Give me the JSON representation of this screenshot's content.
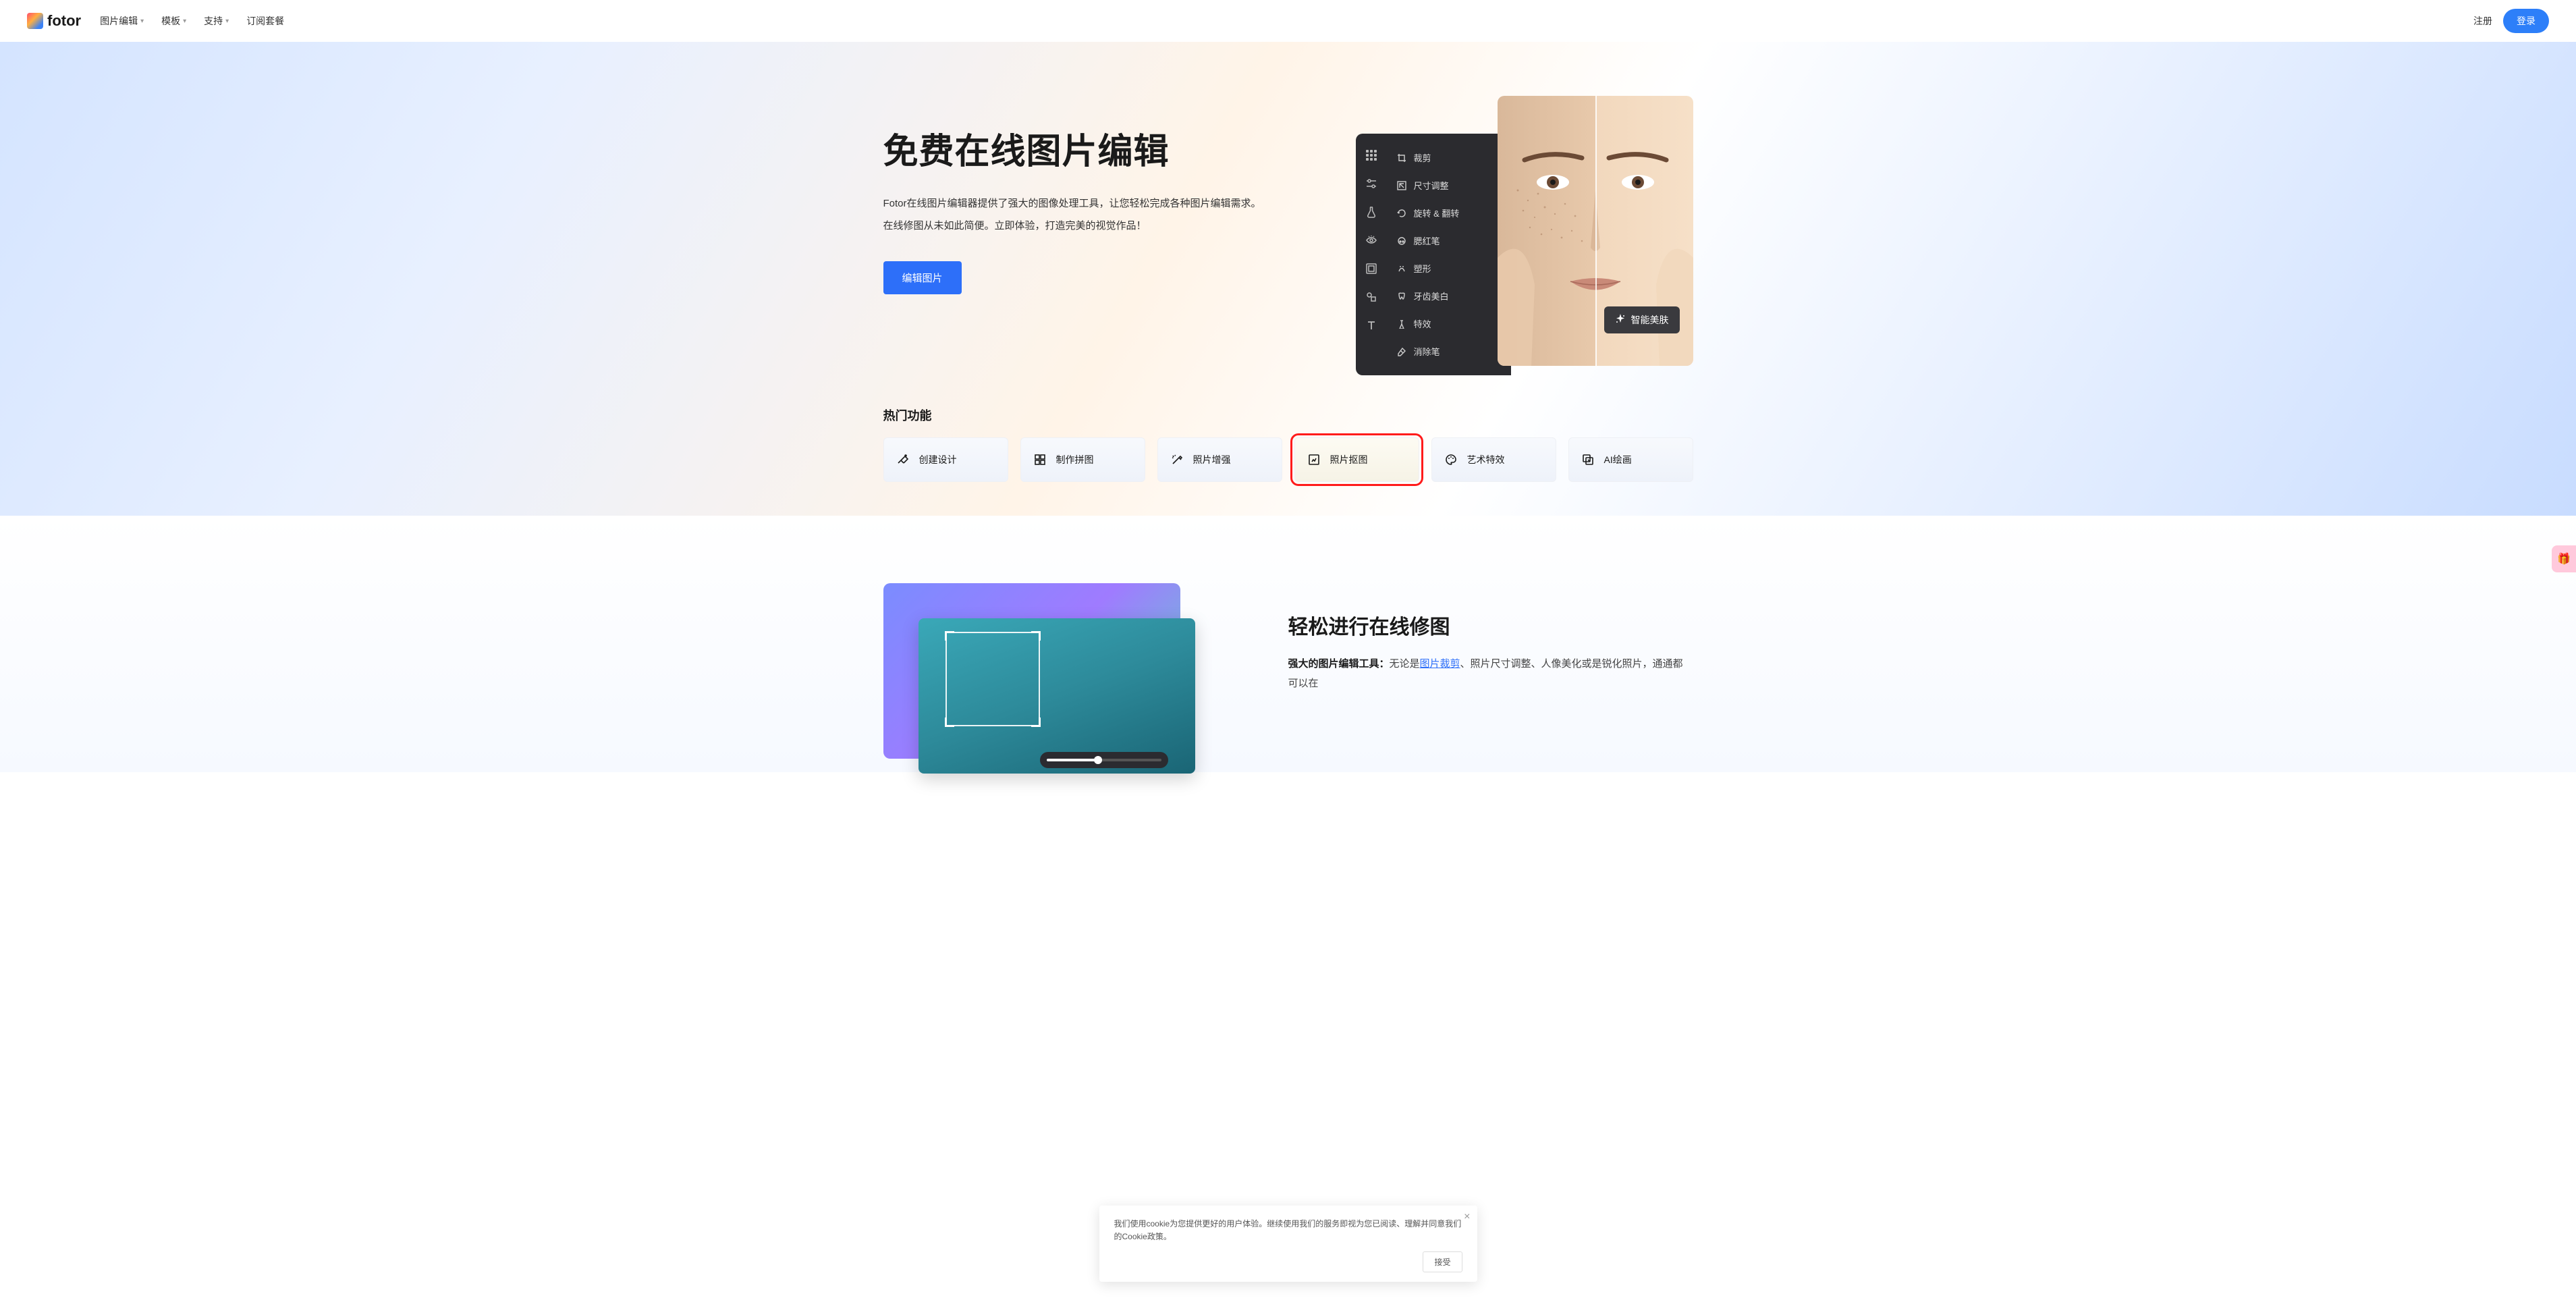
{
  "header": {
    "brand": "fotor",
    "nav": {
      "edit": "图片编辑",
      "template": "模板",
      "support": "支持",
      "subscribe": "订阅套餐"
    },
    "signup": "注册",
    "login": "登录"
  },
  "hero": {
    "title": "免费在线图片编辑",
    "desc1": "Fotor在线图片编辑器提供了强大的图像处理工具，让您轻松完成各种图片编辑需求。",
    "desc2": "在线修图从未如此简便。立即体验，打造完美的视觉作品！",
    "cta": "编辑图片"
  },
  "editor_menu": {
    "crop": "裁剪",
    "resize": "尺寸调整",
    "rotate": "旋转 & 翻转",
    "blush": "腮红笔",
    "reshape": "塑形",
    "teeth": "牙齿美白",
    "effects": "特效",
    "erase": "消除笔"
  },
  "smart_skin": "智能美肤",
  "popular": {
    "title": "热门功能",
    "items": {
      "design": "创建设计",
      "collage": "制作拼图",
      "enhance": "照片增强",
      "cutout": "照片抠图",
      "art_effect": "艺术特效",
      "ai_paint": "AI绘画"
    }
  },
  "lower": {
    "title": "轻松进行在线修图",
    "desc_bold": "强大的图片编辑工具：",
    "desc_text": "无论是",
    "link_crop": "图片裁剪",
    "desc_text2": "、照片尺寸调整、人像美化或是锐化照片，通通都可以在"
  },
  "cookie": {
    "text": "我们使用cookie为您提供更好的用户体验。继续使用我们的服务即视为您已阅读、理解并同意我们的Cookie政策。",
    "accept": "接受"
  }
}
